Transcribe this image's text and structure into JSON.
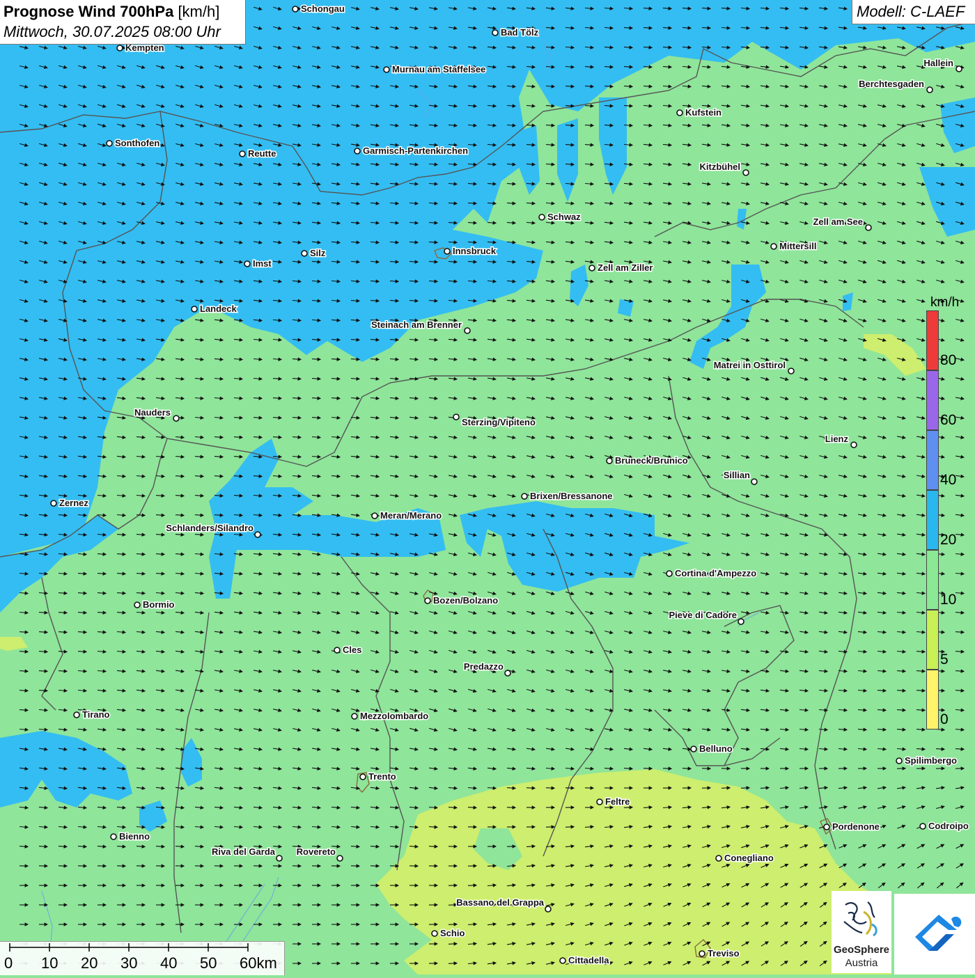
{
  "title": {
    "bold": "Prognose Wind 700hPa",
    "unit": "[km/h]",
    "datetime": "Mittwoch, 30.07.2025 08:00 Uhr"
  },
  "model": "Modell: C-LAEF",
  "legend": {
    "unit": "km/h",
    "labels": [
      "80",
      "60",
      "40",
      "20",
      "10",
      "5",
      "0"
    ],
    "colors": [
      "#ef3a3a",
      "#9a67ea",
      "#5f8ff0",
      "#29b7ef",
      "#8be895",
      "#c8f055",
      "#fff36a"
    ]
  },
  "scalebar": {
    "labels": [
      "0",
      "10",
      "20",
      "30",
      "40",
      "50",
      "60km"
    ]
  },
  "logo": {
    "name": "GeoSphere",
    "sub": "Austria",
    "icon": "geosphere-logo-icon",
    "app_icon": "weather-app-icon"
  },
  "colors": {
    "wind_10_20": "#8fe59a",
    "wind_20_40": "#34bdf2",
    "wind_5_10": "#cdee6e",
    "borders": "#555555"
  },
  "places": [
    {
      "name": "Schongau"
    },
    {
      "name": "Bad Tölz"
    },
    {
      "name": "Kempten"
    },
    {
      "name": "Murnau am Staffelsee"
    },
    {
      "name": "Hallein"
    },
    {
      "name": "Berchtesgaden"
    },
    {
      "name": "Kufstein"
    },
    {
      "name": "Sonthofen"
    },
    {
      "name": "Reutte"
    },
    {
      "name": "Garmisch-Partenkirchen"
    },
    {
      "name": "Kitzbühel"
    },
    {
      "name": "Schwaz"
    },
    {
      "name": "Zell am See"
    },
    {
      "name": "Mittersill"
    },
    {
      "name": "Innsbruck"
    },
    {
      "name": "Silz"
    },
    {
      "name": "Imst"
    },
    {
      "name": "Zell am Ziller"
    },
    {
      "name": "Landeck"
    },
    {
      "name": "Steinach am Brenner"
    },
    {
      "name": "Matrei in Osttirol"
    },
    {
      "name": "Nauders"
    },
    {
      "name": "Sterzing/Vipiteno"
    },
    {
      "name": "Lienz"
    },
    {
      "name": "Bruneck/Brunico"
    },
    {
      "name": "Sillian"
    },
    {
      "name": "Zernez"
    },
    {
      "name": "Brixen/Bressanone"
    },
    {
      "name": "Meran/Merano"
    },
    {
      "name": "Schlanders/Silandro"
    },
    {
      "name": "Cortina d'Ampezzo"
    },
    {
      "name": "Bozen/Bolzano"
    },
    {
      "name": "Bormio"
    },
    {
      "name": "Pieve di Cadore"
    },
    {
      "name": "Cles"
    },
    {
      "name": "Predazzo"
    },
    {
      "name": "Tirano"
    },
    {
      "name": "Mezzolombardo"
    },
    {
      "name": "Belluno"
    },
    {
      "name": "Spilimbergo"
    },
    {
      "name": "Trento"
    },
    {
      "name": "Feltre"
    },
    {
      "name": "Pordenone"
    },
    {
      "name": "Codroipo"
    },
    {
      "name": "Bienno"
    },
    {
      "name": "Riva del Garda"
    },
    {
      "name": "Rovereto"
    },
    {
      "name": "Conegliano"
    },
    {
      "name": "Bassano del Grappa"
    },
    {
      "name": "Schio"
    },
    {
      "name": "Treviso"
    },
    {
      "name": "Cittadella"
    }
  ]
}
